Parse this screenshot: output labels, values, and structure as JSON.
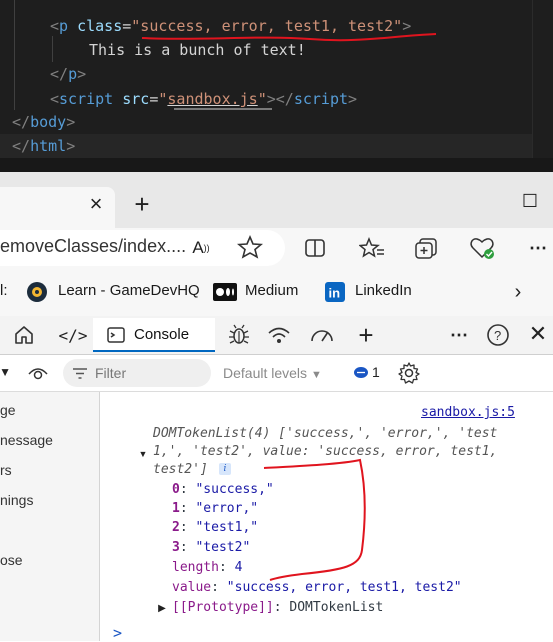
{
  "editor": {
    "line1": {
      "open": "<",
      "tag": "p",
      "attr": "class",
      "eq": "=",
      "value": "\"success, error, test1, test2\"",
      "close": ">"
    },
    "line2": {
      "text": "This is a bunch of text!"
    },
    "line3": {
      "text": "</p>"
    },
    "line4": {
      "open": "<",
      "tag": "script",
      "attr": "src",
      "eq": "=",
      "q1": "\"",
      "file": "sandbox.js",
      "q2": "\"",
      "mid": "></",
      "tag2": "script",
      "close": ">"
    },
    "line5": {
      "text": "</body>"
    },
    "line6": {
      "text": "</html>"
    }
  },
  "browser": {
    "tab_close": "×",
    "new_tab": "+",
    "window_max": "☐",
    "url": "emoveClasses/index....",
    "favorites": [
      {
        "label": "l:"
      },
      {
        "label": "Learn - GameDevHQ"
      },
      {
        "label": "Medium"
      },
      {
        "label": "LinkedIn"
      }
    ]
  },
  "devtools": {
    "console_tab": "Console",
    "filter_placeholder": "Filter",
    "levels": "Default levels",
    "message_count": "1",
    "sidebar": [
      "ge",
      "nessage",
      "rs",
      "nings",
      "ose"
    ],
    "console": {
      "source": "sandbox.js:5",
      "summary_l1": "DOMTokenList(4) ['success,', 'error,', 'test",
      "summary_l2": "1,', 'test2', value: 'success, error, test1,",
      "summary_l3": "test2']",
      "info": "i",
      "items": [
        {
          "key": "0",
          "value": "\"success,\""
        },
        {
          "key": "1",
          "value": "\"error,\""
        },
        {
          "key": "2",
          "value": "\"test1,\""
        },
        {
          "key": "3",
          "value": "\"test2\""
        }
      ],
      "length_key": "length",
      "length_value": "4",
      "value_key": "value",
      "value_value": "\"success, error, test1, test2\"",
      "proto_key": "[[Prototype]]",
      "proto_value": "DOMTokenList",
      "prompt": ">"
    }
  },
  "colors": {
    "annotation": "#e0141e",
    "accent": "#0067c0"
  }
}
